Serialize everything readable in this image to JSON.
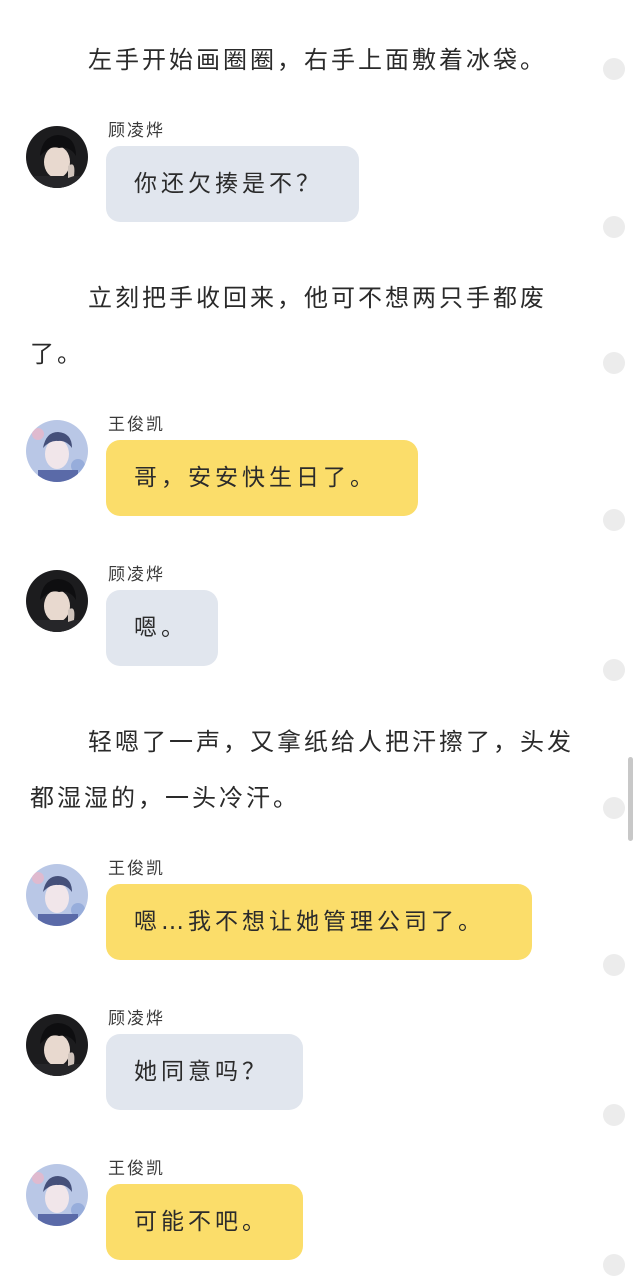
{
  "narration": [
    "左手开始画圈圈，右手上面敷着冰袋。",
    "立刻把手收回来，他可不想两只手都废了。",
    "轻嗯了一声，又拿纸给人把汗擦了，头发都湿湿的，一头冷汗。"
  ],
  "messages": [
    {
      "sender": "顾凌烨",
      "text": "你还欠揍是不？",
      "bubble": "gray",
      "avatar": "dark-haired-avatar"
    },
    {
      "sender": "王俊凯",
      "text": "哥，安安快生日了。",
      "bubble": "yellow",
      "avatar": "blue-tinted-avatar"
    },
    {
      "sender": "顾凌烨",
      "text": "嗯。",
      "bubble": "gray",
      "avatar": "dark-haired-avatar"
    },
    {
      "sender": "王俊凯",
      "text": "嗯…我不想让她管理公司了。",
      "bubble": "yellow",
      "avatar": "blue-tinted-avatar"
    },
    {
      "sender": "顾凌烨",
      "text": "她同意吗？",
      "bubble": "gray",
      "avatar": "dark-haired-avatar"
    },
    {
      "sender": "王俊凯",
      "text": "可能不吧。",
      "bubble": "yellow",
      "avatar": "blue-tinted-avatar"
    }
  ],
  "colors": {
    "gray_bubble": "#e1e6ee",
    "yellow_bubble": "#fbdd6a",
    "side_dot": "#ececec"
  }
}
